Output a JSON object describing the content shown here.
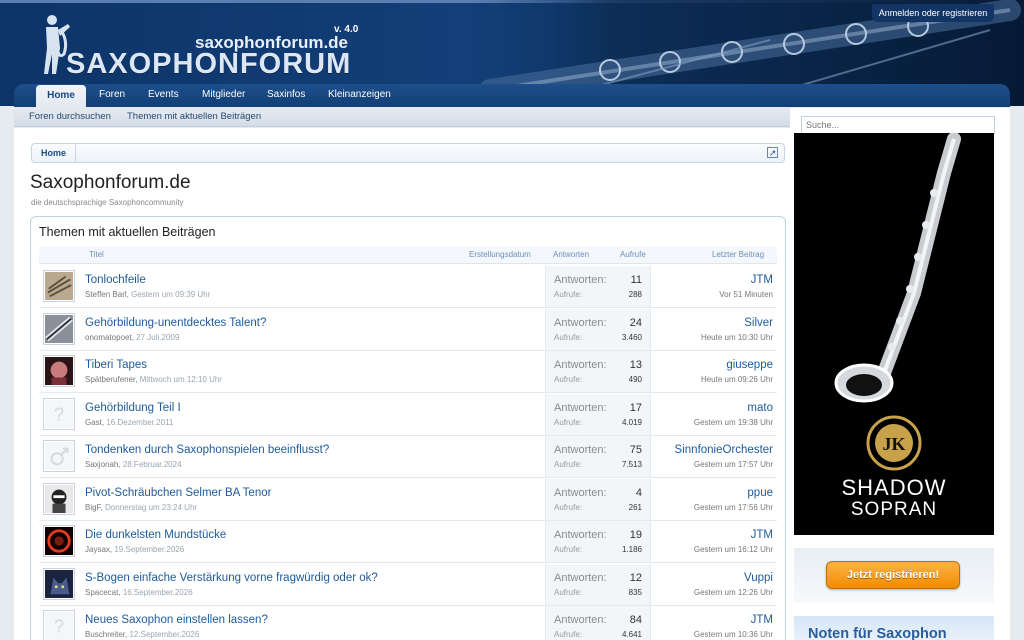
{
  "header": {
    "site_url": "saxophonforum.de",
    "site_version": "v. 4.0",
    "site_logo": "SAXOPHONFORUM",
    "login_link": "Anmelden oder registrieren"
  },
  "nav": {
    "tabs": [
      "Home",
      "Foren",
      "Events",
      "Mitglieder",
      "Saxinfos",
      "Kleinanzeigen"
    ],
    "active": "Home"
  },
  "subnav": [
    "Foren durchsuchen",
    "Themen mit aktuellen Beiträgen"
  ],
  "breadcrumb": {
    "home": "Home"
  },
  "page": {
    "title": "Saxophonforum.de",
    "description": "die deutschsprachige Saxophoncommunity"
  },
  "threads": {
    "title": "Themen mit aktuellen Beiträgen",
    "columns": {
      "title": "Titel",
      "created": "Erstellungsdatum",
      "replies": "Antworten",
      "views": "Aufrufe",
      "last_post": "Letzter Beitrag"
    },
    "replies_label": "Antworten:",
    "views_label": "Aufrufe:",
    "rows": [
      {
        "title": "Tonlochfeile",
        "author": "Steffen Barl",
        "date": "Gestern um 09:39 Uhr",
        "replies": "11",
        "views": "288",
        "last_user": "JTM",
        "last_time": "Vor 51 Minuten",
        "avatar": "photo-tools"
      },
      {
        "title": "Gehörbildung-unentdecktes Talent?",
        "author": "onomatopoet",
        "date": "27.Juli.2009",
        "replies": "24",
        "views": "3.460",
        "last_user": "Silver",
        "last_time": "Heute um 10:30 Uhr",
        "avatar": "photo-sax"
      },
      {
        "title": "Tiberi Tapes",
        "author": "Spätberufener",
        "date": "Mittwoch um 12:10 Uhr",
        "replies": "13",
        "views": "490",
        "last_user": "giuseppe",
        "last_time": "Heute um 09:26 Uhr",
        "avatar": "photo-face"
      },
      {
        "title": "Gehörbildung Teil I",
        "author": "Gast",
        "date": "16.Dezember.2011",
        "replies": "17",
        "views": "4.019",
        "last_user": "mato",
        "last_time": "Gestern um 19:38 Uhr",
        "avatar": "placeholder-unknown"
      },
      {
        "title": "Tondenken durch Saxophonspielen beeinflusst?",
        "author": "Saxjonah",
        "date": "28.Februar.2024",
        "replies": "75",
        "views": "7.513",
        "last_user": "SinnfonieOrchester",
        "last_time": "Gestern um 17:57 Uhr",
        "avatar": "placeholder-male"
      },
      {
        "title": "Pivot-Schräubchen Selmer BA Tenor",
        "author": "BigF",
        "date": "Donnerstag um 23:24 Uhr",
        "replies": "4",
        "views": "261",
        "last_user": "ppue",
        "last_time": "Gestern um 17:56 Uhr",
        "avatar": "photo-bw"
      },
      {
        "title": "Die dunkelsten Mundstücke",
        "author": "Jaysax",
        "date": "19.September.2026",
        "replies": "19",
        "views": "1.186",
        "last_user": "JTM",
        "last_time": "Gestern um 16:12 Uhr",
        "avatar": "photo-red"
      },
      {
        "title": "S-Bogen einfache Verstärkung vorne fragwürdig oder ok?",
        "author": "Spacecat",
        "date": "16.September.2026",
        "replies": "12",
        "views": "835",
        "last_user": "Vuppi",
        "last_time": "Gestern um 12:26 Uhr",
        "avatar": "photo-cat"
      },
      {
        "title": "Neues Saxophon einstellen lassen?",
        "author": "Buschreiter",
        "date": "12.September.2026",
        "replies": "84",
        "views": "4.641",
        "last_user": "JTM",
        "last_time": "Gestern um 10:36 Uhr",
        "avatar": "placeholder-unknown"
      }
    ]
  },
  "sidebar": {
    "search_placeholder": "Suche...",
    "ad": {
      "line1": "SHADOW",
      "line2": "SOPRAN",
      "badge": "JK"
    },
    "register_button": "Jetzt registrieren!",
    "banner_text": "Noten für Saxophon"
  },
  "colors": {
    "header": "#123f78",
    "link": "#1d5b9c",
    "register": "#f08c00"
  }
}
